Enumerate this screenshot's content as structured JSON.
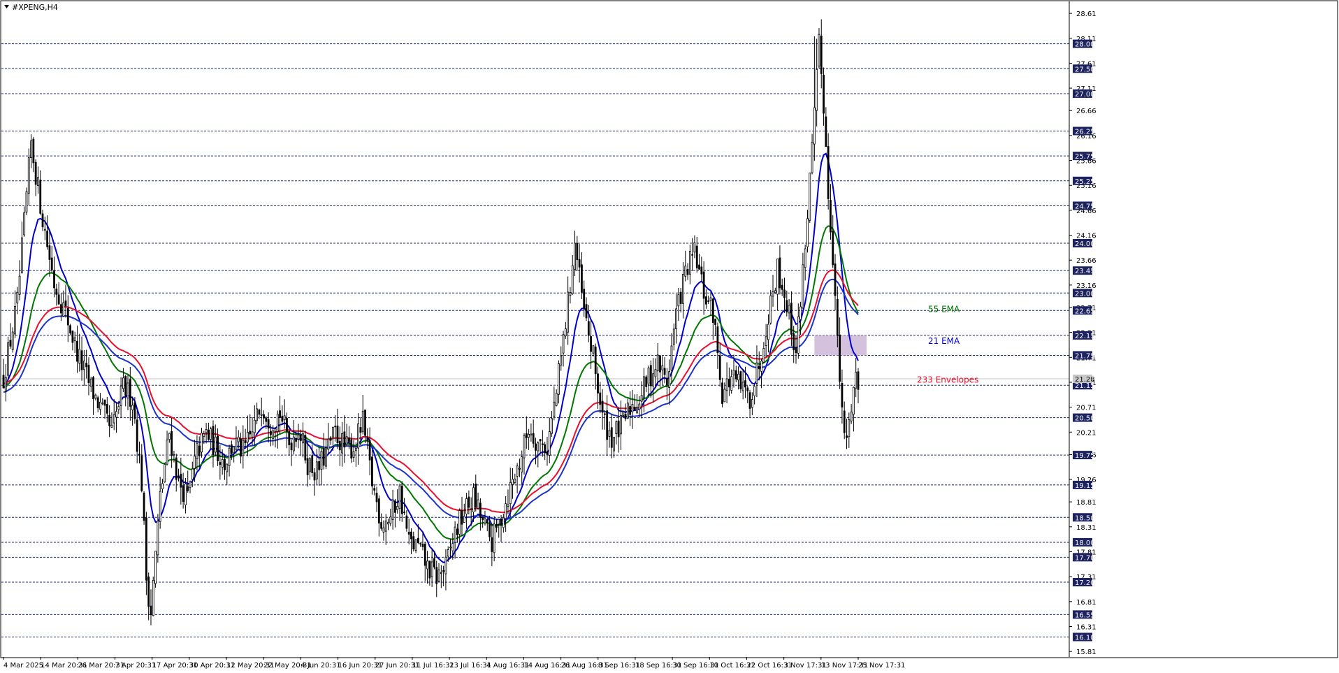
{
  "window": {
    "symbol": "#XPENG,H4"
  },
  "chart_data": {
    "type": "candlestick",
    "symbol": "#XPENG,H4",
    "timeframe": "H4",
    "ylim": [
      15.7,
      28.85
    ],
    "grid": false,
    "price_ticks": [
      "28.61",
      "28.11",
      "27.61",
      "27.11",
      "26.66",
      "26.16",
      "25.66",
      "25.16",
      "24.66",
      "24.16",
      "23.66",
      "23.16",
      "22.71",
      "22.21",
      "21.71",
      "21.21",
      "20.71",
      "20.21",
      "19.76",
      "19.26",
      "18.81",
      "18.31",
      "17.81",
      "17.31",
      "16.81",
      "16.31",
      "15.81"
    ],
    "time_labels": [
      "4 Mar 2025",
      "14 Mar 20:31",
      "26 Mar 20:31",
      "7 Apr 20:31",
      "17 Apr 20:31",
      "30 Apr 20:31",
      "12 May 20:31",
      "22 May 20:31",
      "4 Jun 20:31",
      "16 Jun 20:31",
      "27 Jun 20:31",
      "11 Jul 16:31",
      "23 Jul 16:31",
      "4 Aug 16:31",
      "14 Aug 16:31",
      "26 Aug 16:31",
      "8 Sep 16:31",
      "18 Sep 16:31",
      "30 Sep 16:31",
      "10 Oct 16:31",
      "22 Oct 16:31",
      "3 Nov 17:31",
      "13 Nov 17:31",
      "25 Nov 17:31"
    ],
    "horizontal_levels": [
      28.0,
      27.5,
      27.0,
      26.25,
      25.75,
      25.25,
      24.75,
      24.0,
      23.45,
      23.0,
      22.65,
      22.15,
      21.75,
      21.15,
      20.5,
      19.75,
      19.15,
      18.5,
      18.0,
      17.7,
      17.2,
      16.55,
      16.1
    ],
    "current_price": 21.28,
    "close_anchors": [
      [
        0,
        21.3
      ],
      [
        6,
        22.8
      ],
      [
        12,
        26.0
      ],
      [
        17,
        24.5
      ],
      [
        22,
        23.2
      ],
      [
        27,
        22.6
      ],
      [
        32,
        21.8
      ],
      [
        37,
        21.2
      ],
      [
        42,
        20.7
      ],
      [
        47,
        20.2
      ],
      [
        52,
        21.1
      ],
      [
        56,
        20.9
      ],
      [
        60,
        19.2
      ],
      [
        62,
        17.3
      ],
      [
        64,
        16.6
      ],
      [
        68,
        18.9
      ],
      [
        72,
        20.2
      ],
      [
        76,
        19.2
      ],
      [
        80,
        18.9
      ],
      [
        84,
        19.8
      ],
      [
        88,
        20.2
      ],
      [
        92,
        19.9
      ],
      [
        96,
        19.6
      ],
      [
        100,
        20.0
      ],
      [
        104,
        19.8
      ],
      [
        108,
        20.2
      ],
      [
        112,
        20.8
      ],
      [
        116,
        20.4
      ],
      [
        120,
        20.6
      ],
      [
        124,
        20.0
      ],
      [
        128,
        20.3
      ],
      [
        132,
        19.6
      ],
      [
        136,
        19.4
      ],
      [
        140,
        19.8
      ],
      [
        144,
        20.2
      ],
      [
        148,
        19.9
      ],
      [
        152,
        19.9
      ],
      [
        156,
        20.4
      ],
      [
        160,
        19.2
      ],
      [
        164,
        18.4
      ],
      [
        168,
        18.5
      ],
      [
        172,
        19.0
      ],
      [
        176,
        18.0
      ],
      [
        180,
        17.9
      ],
      [
        184,
        17.5
      ],
      [
        188,
        17.3
      ],
      [
        192,
        17.5
      ],
      [
        196,
        18.2
      ],
      [
        200,
        18.6
      ],
      [
        204,
        18.9
      ],
      [
        208,
        18.4
      ],
      [
        212,
        18.0
      ],
      [
        216,
        18.5
      ],
      [
        220,
        19.1
      ],
      [
        224,
        19.6
      ],
      [
        228,
        20.3
      ],
      [
        232,
        20.0
      ],
      [
        236,
        19.9
      ],
      [
        240,
        21.0
      ],
      [
        244,
        22.4
      ],
      [
        248,
        24.0
      ],
      [
        252,
        22.6
      ],
      [
        256,
        21.7
      ],
      [
        260,
        20.5
      ],
      [
        264,
        20.1
      ],
      [
        268,
        20.3
      ],
      [
        272,
        20.7
      ],
      [
        276,
        20.9
      ],
      [
        280,
        21.3
      ],
      [
        284,
        21.6
      ],
      [
        288,
        21.2
      ],
      [
        292,
        22.6
      ],
      [
        296,
        23.4
      ],
      [
        300,
        23.8
      ],
      [
        304,
        23.0
      ],
      [
        308,
        22.6
      ],
      [
        312,
        21.0
      ],
      [
        316,
        21.3
      ],
      [
        320,
        21.1
      ],
      [
        324,
        20.9
      ],
      [
        328,
        21.6
      ],
      [
        332,
        22.6
      ],
      [
        336,
        23.5
      ],
      [
        340,
        22.8
      ],
      [
        344,
        21.8
      ],
      [
        348,
        24.0
      ],
      [
        352,
        26.5
      ],
      [
        354,
        28.0
      ],
      [
        356,
        26.8
      ],
      [
        358,
        25.0
      ],
      [
        360,
        23.8
      ],
      [
        362,
        22.0
      ],
      [
        364,
        20.5
      ],
      [
        366,
        20.0
      ],
      [
        368,
        20.8
      ],
      [
        370,
        21.4
      ],
      [
        371,
        21.1
      ]
    ],
    "series": [
      {
        "name": "21 EMA",
        "color": "#0000cc",
        "period": 21,
        "type": "ema"
      },
      {
        "name": "55 EMA",
        "color": "#007700",
        "period": 55,
        "type": "ema"
      },
      {
        "name": "233 Envelopes",
        "color": "#e8102e",
        "period": 233,
        "type": "envelope-upper"
      },
      {
        "color": "#1c33c9",
        "period": 233,
        "type": "envelope-lower"
      }
    ],
    "highlight_zone": {
      "price_low": 21.75,
      "price_high": 22.15,
      "color": "#cdb6d8"
    },
    "annotations": [
      {
        "text": "55 EMA",
        "color": "#007700"
      },
      {
        "text": "21 EMA",
        "color": "#0000cc"
      },
      {
        "text": "233 Envelopes",
        "color": "#e8102e"
      }
    ]
  }
}
